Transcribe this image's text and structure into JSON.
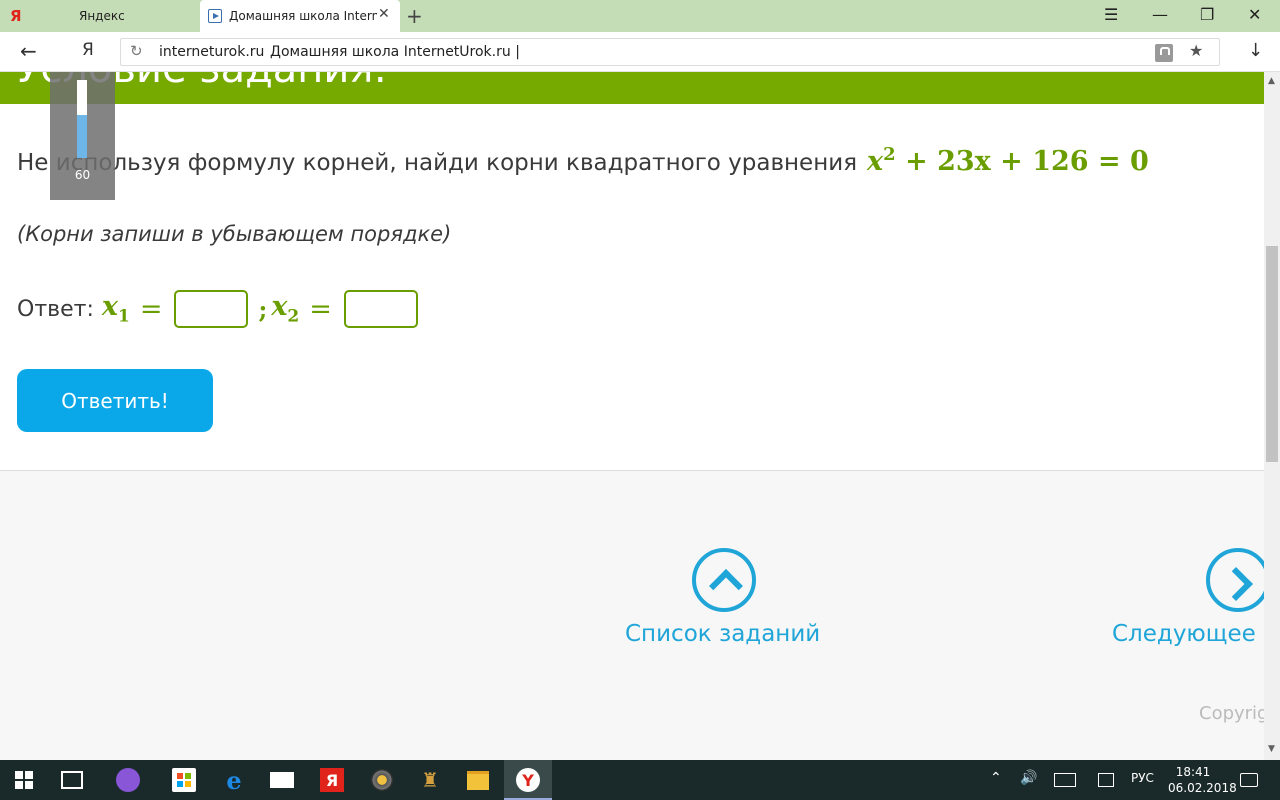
{
  "browser": {
    "tabs": [
      {
        "logo": "Я",
        "label": "Яндекс"
      },
      {
        "label": "Домашняя школа Interne",
        "close": "✕"
      }
    ],
    "new_tab": "+",
    "window_controls": {
      "menu": "☰",
      "minimize": "—",
      "restore": "❐",
      "close": "✕"
    },
    "back": "←",
    "ya_button": "Я",
    "url_domain": "interneturok.ru",
    "url_title": "Домашняя школа InternetUrok.ru |",
    "star": "★",
    "download": "↓",
    "reload": "↻"
  },
  "page": {
    "header_text": "Условие задания:",
    "speed_widget": {
      "value": "60",
      "fill_fraction": 0.55
    },
    "question_text": "Не используя формулу корней, найди корни квадратного уравнения",
    "equation": {
      "var": "x",
      "power": "2",
      "rest": "+ 23x + 126 = 0"
    },
    "hint": "(Корни запиши в убывающем порядке)",
    "answer": {
      "label": "Ответ:",
      "x1": "x",
      "x1_sub": "1",
      "eq": "=",
      "sep": ";",
      "x2": "x",
      "x2_sub": "2"
    },
    "submit_label": "Ответить!",
    "nav": {
      "list_label": "Список заданий",
      "next_label": "Следующее"
    },
    "copyright": "Copyrig"
  },
  "scrollbar": {
    "up": "▲",
    "down": "▼"
  },
  "taskbar": {
    "edge_glyph": "e",
    "yabrowser_glyph": "Я",
    "game_glyph": "♜",
    "yandex_glyph": "Y",
    "tray": {
      "up": "⌃",
      "volume": "🔊",
      "lang": "РУС",
      "time": "18:41",
      "date": "06.02.2018"
    }
  },
  "colors": {
    "green": "#76aa00",
    "math_green": "#6a9e00",
    "button_blue": "#0aa8e8",
    "link_blue": "#20a5d8"
  }
}
